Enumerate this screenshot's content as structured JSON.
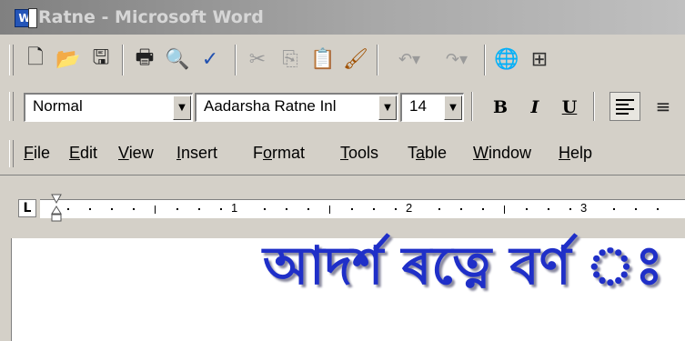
{
  "window": {
    "title": "Ratne - Microsoft Word",
    "app_icon_letter": "W"
  },
  "standard_toolbar": {
    "buttons": [
      {
        "name": "new-document-icon",
        "glyph": "🗋"
      },
      {
        "name": "open-folder-icon",
        "glyph": "📂"
      },
      {
        "name": "save-icon",
        "glyph": "💾"
      },
      {
        "name": "print-icon",
        "glyph": "🖶"
      },
      {
        "name": "print-preview-icon",
        "glyph": "🔍"
      },
      {
        "name": "spelling-icon",
        "glyph": "✓"
      },
      {
        "name": "cut-icon",
        "glyph": "✂"
      },
      {
        "name": "copy-icon",
        "glyph": "⎘"
      },
      {
        "name": "paste-icon",
        "glyph": "📋"
      },
      {
        "name": "format-painter-icon",
        "glyph": "🖌"
      },
      {
        "name": "undo-icon",
        "glyph": "↶▾"
      },
      {
        "name": "redo-icon",
        "glyph": "↷▾"
      },
      {
        "name": "insert-hyperlink-icon",
        "glyph": "🌐"
      },
      {
        "name": "tables-borders-icon",
        "glyph": "⊞"
      }
    ]
  },
  "formatting_toolbar": {
    "style": "Normal",
    "font": "Aadarsha Ratne Inl",
    "size": "14",
    "bold": "B",
    "italic": "I",
    "underline": "U"
  },
  "menu": {
    "items": [
      {
        "key": "F",
        "rest": "ile"
      },
      {
        "key": "E",
        "rest": "dit"
      },
      {
        "key": "V",
        "rest": "iew"
      },
      {
        "key": "I",
        "rest": "nsert"
      },
      {
        "pre": "F",
        "key": "o",
        "rest": "rmat"
      },
      {
        "key": "T",
        "rest": "ools"
      },
      {
        "pre": "T",
        "key": "a",
        "rest": "ble"
      },
      {
        "key": "W",
        "rest": "indow"
      },
      {
        "key": "H",
        "rest": "elp"
      }
    ]
  },
  "ruler": {
    "tab_stop": "L",
    "numbers": [
      "1",
      "2",
      "3"
    ]
  },
  "document": {
    "text": "আদৰ্শ ৰত্নে বৰ্ণ ঃ"
  },
  "colors": {
    "title_gradient_start": "#808080",
    "document_text": "#1f2fc8"
  }
}
